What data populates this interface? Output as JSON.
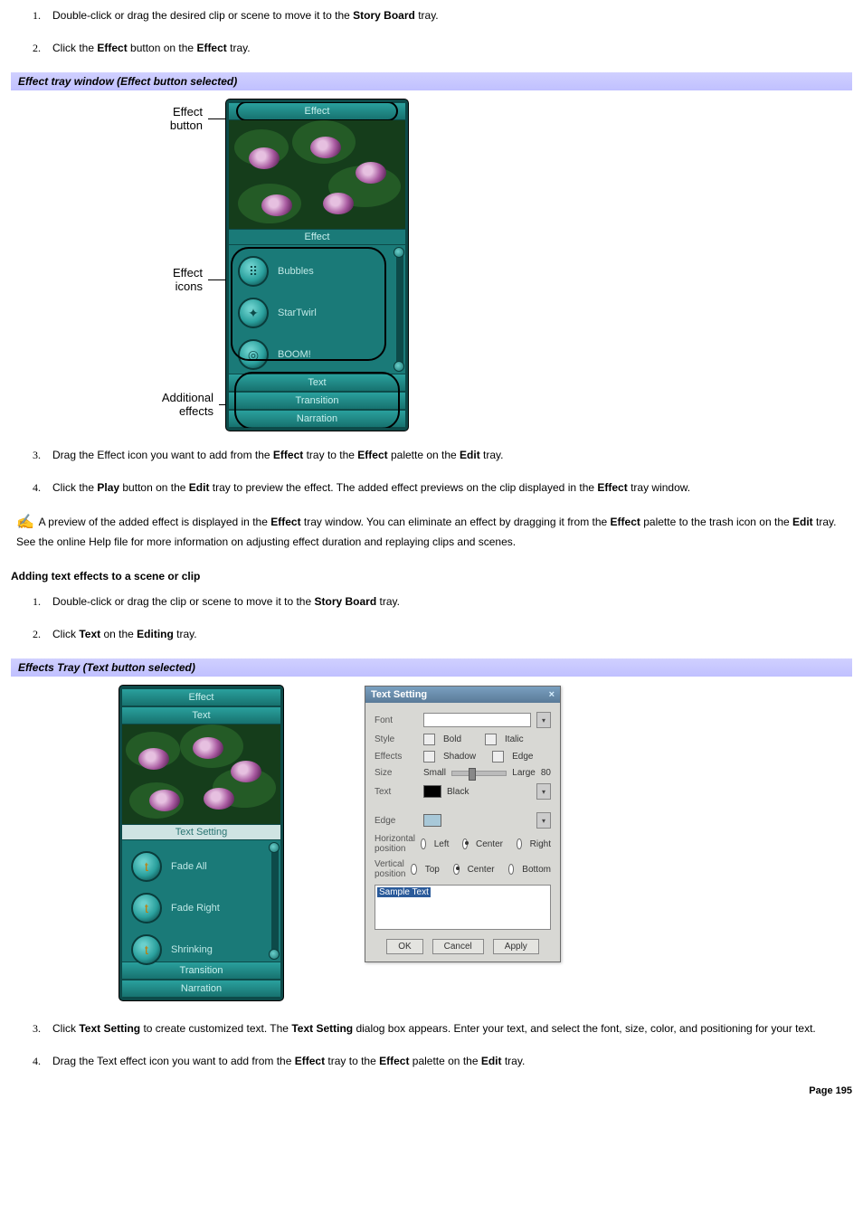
{
  "steps_a": [
    {
      "num": "1.",
      "html": "Double-click or drag the desired clip or scene to move it to the <b>Story Board</b> tray."
    },
    {
      "num": "2.",
      "html": "Click the <b>Effect</b> button on the <b>Effect</b> tray."
    }
  ],
  "bar1": "Effect tray window (Effect button selected)",
  "fig1": {
    "callouts": {
      "button": "Effect\nbutton",
      "icons": "Effect\nicons",
      "additional": "Additional\neffects"
    },
    "tabs": {
      "top": "Effect",
      "text": "Text",
      "mid": "Effect",
      "transition": "Transition",
      "narration": "Narration"
    },
    "effects": [
      "Bubbles",
      "StarTwirl",
      "BOOM!"
    ]
  },
  "steps_b": [
    {
      "num": "3.",
      "html": "Drag the Effect icon you want to add from the <b>Effect</b> tray to the <b>Effect</b> palette on the <b>Edit</b> tray."
    },
    {
      "num": "4.",
      "html": "Click the <b>Play</b> button on the <b>Edit</b> tray to preview the effect. The added effect previews on the clip displayed in the <b>Effect</b> tray window."
    }
  ],
  "note_html": "A preview of the added effect is displayed in the <b>Effect</b> tray window. You can eliminate an effect by dragging it from the <b>Effect</b> palette to the trash icon on the <b>Edit</b> tray. See the online Help file for more information on adjusting effect duration and replaying clips and scenes.",
  "subhead": "Adding text effects to a scene or clip",
  "steps_c": [
    {
      "num": "1.",
      "html": "Double-click or drag the clip or scene to move it to the <b>Story Board</b> tray."
    },
    {
      "num": "2.",
      "html": "Click <b>Text</b> on the <b>Editing</b> tray."
    }
  ],
  "bar2": "Effects Tray (Text button selected)",
  "fig2": {
    "panel": {
      "tabs": {
        "effect": "Effect",
        "text": "Text",
        "setting": "Text Setting",
        "transition": "Transition",
        "narration": "Narration"
      },
      "items": [
        "Fade All",
        "Fade Right",
        "Shrinking"
      ]
    },
    "dialog": {
      "title": "Text Setting",
      "labels": {
        "font": "Font",
        "style": "Style",
        "bold": "Bold",
        "italic": "Italic",
        "effects": "Effects",
        "shadow": "Shadow",
        "edgechk": "Edge",
        "size": "Size",
        "small": "Small",
        "large": "Large",
        "sizeval": "80",
        "text": "Text",
        "black": "Black",
        "edge": "Edge",
        "hpos": "Horizontal\nposition",
        "vpos": "Vertical\nposition",
        "left": "Left",
        "center": "Center",
        "right": "Right",
        "top": "Top",
        "bottom": "Bottom",
        "sample": "Sample Text"
      },
      "buttons": {
        "ok": "OK",
        "cancel": "Cancel",
        "apply": "Apply"
      }
    }
  },
  "steps_d": [
    {
      "num": "3.",
      "html": "Click <b>Text Setting</b> to create customized text. The <b>Text Setting</b> dialog box appears. Enter your text, and select the font, size, color, and positioning for your text."
    },
    {
      "num": "4.",
      "html": "Drag the Text effect icon you want to add from the <b>Effect</b> tray to the <b>Effect</b> palette on the <b>Edit</b> tray."
    }
  ],
  "page": "Page 195"
}
